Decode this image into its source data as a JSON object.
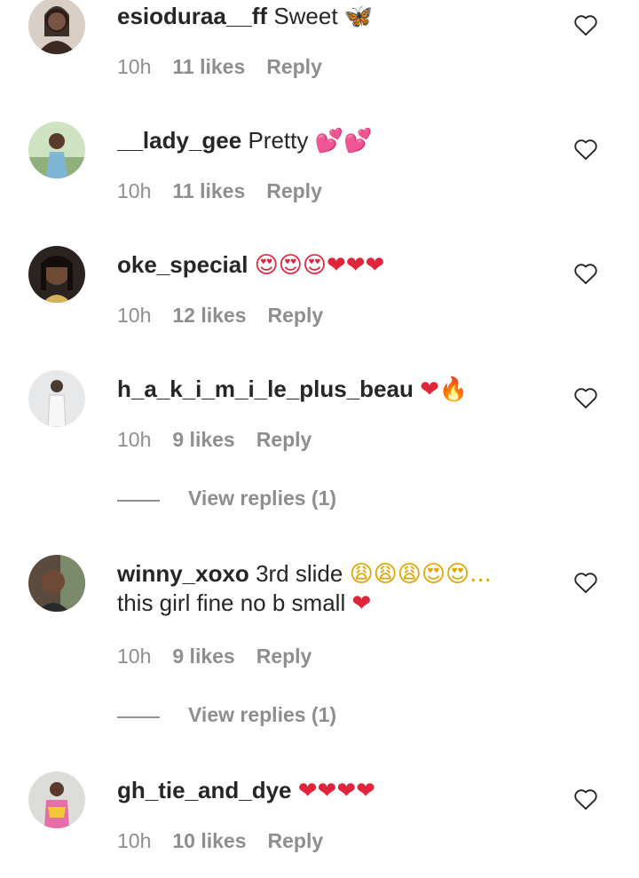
{
  "comments": [
    {
      "username": "esioduraa__ff",
      "text": "Sweet",
      "emojis": "🦋",
      "time": "10h",
      "likes": "11 likes",
      "reply": "Reply",
      "avatar_color": "#6b4a3a"
    },
    {
      "username": "__lady_gee",
      "text": "Pretty",
      "emojis": "💕💕",
      "time": "10h",
      "likes": "11 likes",
      "reply": "Reply",
      "avatar_color": "#7da2b8"
    },
    {
      "username": "oke_special",
      "text": "",
      "emojis": "😍😍😍❤❤❤",
      "time": "10h",
      "likes": "12 likes",
      "reply": "Reply",
      "avatar_color": "#3a2a22"
    },
    {
      "username": "h_a_k_i_m_i_le_plus_beau",
      "text": "",
      "emojis": "❤🔥",
      "time": "10h",
      "likes": "9 likes",
      "reply": "Reply",
      "view_replies": "View replies (1)",
      "avatar_color": "#bfc3c7"
    },
    {
      "username": "winny_xoxo",
      "text": "3rd slide",
      "emojis": "😩😩😩😍😍...",
      "text2": "this girl fine no b small",
      "emojis2": "❤",
      "time": "10h",
      "likes": "9 likes",
      "reply": "Reply",
      "view_replies": "View replies (1)",
      "avatar_color": "#4a3a30"
    },
    {
      "username": "gh_tie_and_dye",
      "text": "",
      "emojis": "❤❤❤❤",
      "time": "10h",
      "likes": "10 likes",
      "reply": "Reply",
      "avatar_color": "#c9a36e"
    }
  ],
  "icons": {
    "like": "heart-outline-icon"
  },
  "colors": {
    "text": "#262626",
    "muted": "#8e8e8e",
    "heart": "#e0243b"
  }
}
